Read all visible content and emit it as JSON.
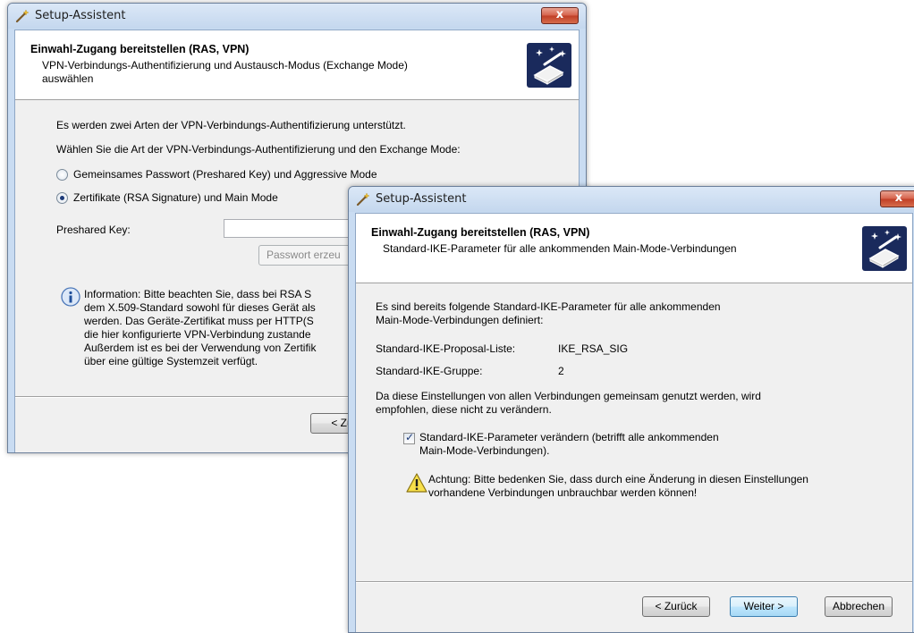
{
  "back_window": {
    "title": "Setup-Assistent",
    "close_label": "x",
    "header": {
      "title": "Einwahl-Zugang bereitstellen (RAS, VPN)",
      "subtitle_line1": "VPN-Verbindungs-Authentifizierung und Austausch-Modus (Exchange Mode)",
      "subtitle_line2": "auswählen"
    },
    "intro1": "Es werden zwei Arten der VPN-Verbindungs-Authentifizierung unterstützt.",
    "intro2": "Wählen Sie die Art der VPN-Verbindungs-Authentifizierung und den Exchange Mode:",
    "radio_psk": {
      "label": "Gemeinsames Passwort (Preshared Key) und Aggressive Mode",
      "checked": false
    },
    "radio_rsa": {
      "label": "Zertifikate (RSA Signature) und Main Mode",
      "checked": true
    },
    "preshared_label": "Preshared Key:",
    "preshared_value": "",
    "generate_button": "Passwort erzeu",
    "info_lines": [
      "Information:   Bitte beachten Sie, dass bei RSA S",
      "dem X.509-Standard sowohl für dieses Gerät als",
      "werden. Das Geräte-Zertifikat muss per HTTP(S",
      "die hier konfigurierte VPN-Verbindung zustande",
      "Außerdem ist es bei der Verwendung von Zertifik",
      "über eine gültige Systemzeit verfügt."
    ],
    "back_button": "< Zur"
  },
  "front_window": {
    "title": "Setup-Assistent",
    "close_label": "x",
    "header": {
      "title": "Einwahl-Zugang bereitstellen (RAS, VPN)",
      "subtitle": "Standard-IKE-Parameter für alle ankommenden Main-Mode-Verbindungen"
    },
    "intro_line1": "Es sind bereits folgende Standard-IKE-Parameter für alle ankommenden",
    "intro_line2": "Main-Mode-Verbindungen definiert:",
    "proposal_label": "Standard-IKE-Proposal-Liste:",
    "proposal_value": "IKE_RSA_SIG",
    "group_label": "Standard-IKE-Gruppe:",
    "group_value": "2",
    "note_line1": "Da diese Einstellungen von allen Verbindungen gemeinsam genutzt werden, wird",
    "note_line2": "empfohlen, diese nicht zu verändern.",
    "checkbox": {
      "line1": "Standard-IKE-Parameter verändern (betrifft alle ankommenden",
      "line2": "Main-Mode-Verbindungen).",
      "checked": true
    },
    "warning_line1": "Achtung: Bitte bedenken Sie, dass durch eine Änderung in diesen Einstellungen",
    "warning_line2": "vorhandene Verbindungen unbrauchbar werden können!",
    "buttons": {
      "back": "< Zurück",
      "next": "Weiter >",
      "cancel": "Abbrechen"
    }
  },
  "icons": {
    "title_icon": "wizard-wand-icon",
    "header_icon": "vpn-device-sparkle-icon",
    "info_icon": "info-icon",
    "warning_icon": "warning-icon"
  },
  "colors": {
    "titlebar": "#c4d7ee",
    "close_button": "#c03e26",
    "client_bg": "#f0f0f0",
    "default_button": "#a7d9f5",
    "icon_bg": "#1a2a5c"
  }
}
